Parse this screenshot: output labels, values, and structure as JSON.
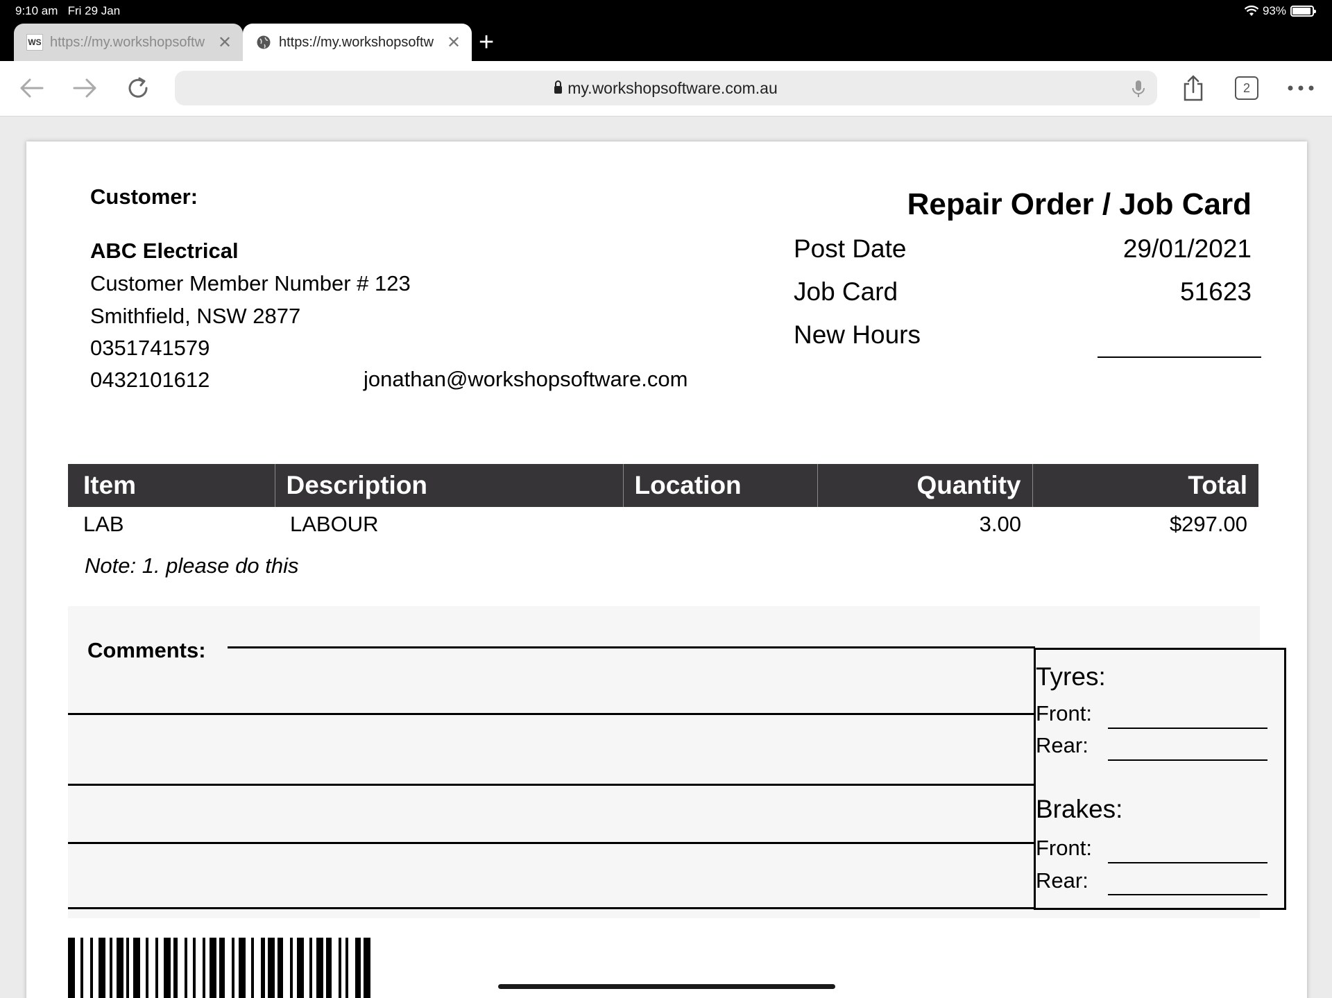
{
  "status": {
    "time": "9:10 am",
    "date": "Fri 29 Jan",
    "battery": "93%",
    "battery_level": 0.93
  },
  "tabs": [
    {
      "favicon": "WS",
      "title": "https://my.workshopsoftw",
      "active": false
    },
    {
      "favicon": "globe-icon",
      "title": "https://my.workshopsoftw",
      "active": true
    }
  ],
  "toolbar": {
    "url": "my.workshopsoftware.com.au",
    "tab_count": "2"
  },
  "document": {
    "customer_label": "Customer:",
    "customer_name": "ABC Electrical",
    "customer_lines": [
      "Customer Member Number # 123",
      "Smithfield, NSW 2877",
      "0351741579",
      "0432101612"
    ],
    "email": "jonathan@workshopsoftware.com",
    "title": "Repair Order / Job Card",
    "meta": [
      {
        "label": "Post Date",
        "value": "29/01/2021"
      },
      {
        "label": "Job Card",
        "value": "51623"
      },
      {
        "label": "New Hours",
        "value": ""
      }
    ],
    "table": {
      "headers": [
        "Item",
        "Description",
        "Location",
        "Quantity",
        "Total"
      ],
      "rows": [
        {
          "item": "LAB",
          "description": "LABOUR",
          "location": "",
          "quantity": "3.00",
          "total": "$297.00"
        }
      ]
    },
    "note": "Note: 1. please do this",
    "comments_label": "Comments:",
    "tyres_label": "Tyres:",
    "brakes_label": "Brakes:",
    "front_label": "Front:",
    "rear_label": "Rear:"
  }
}
